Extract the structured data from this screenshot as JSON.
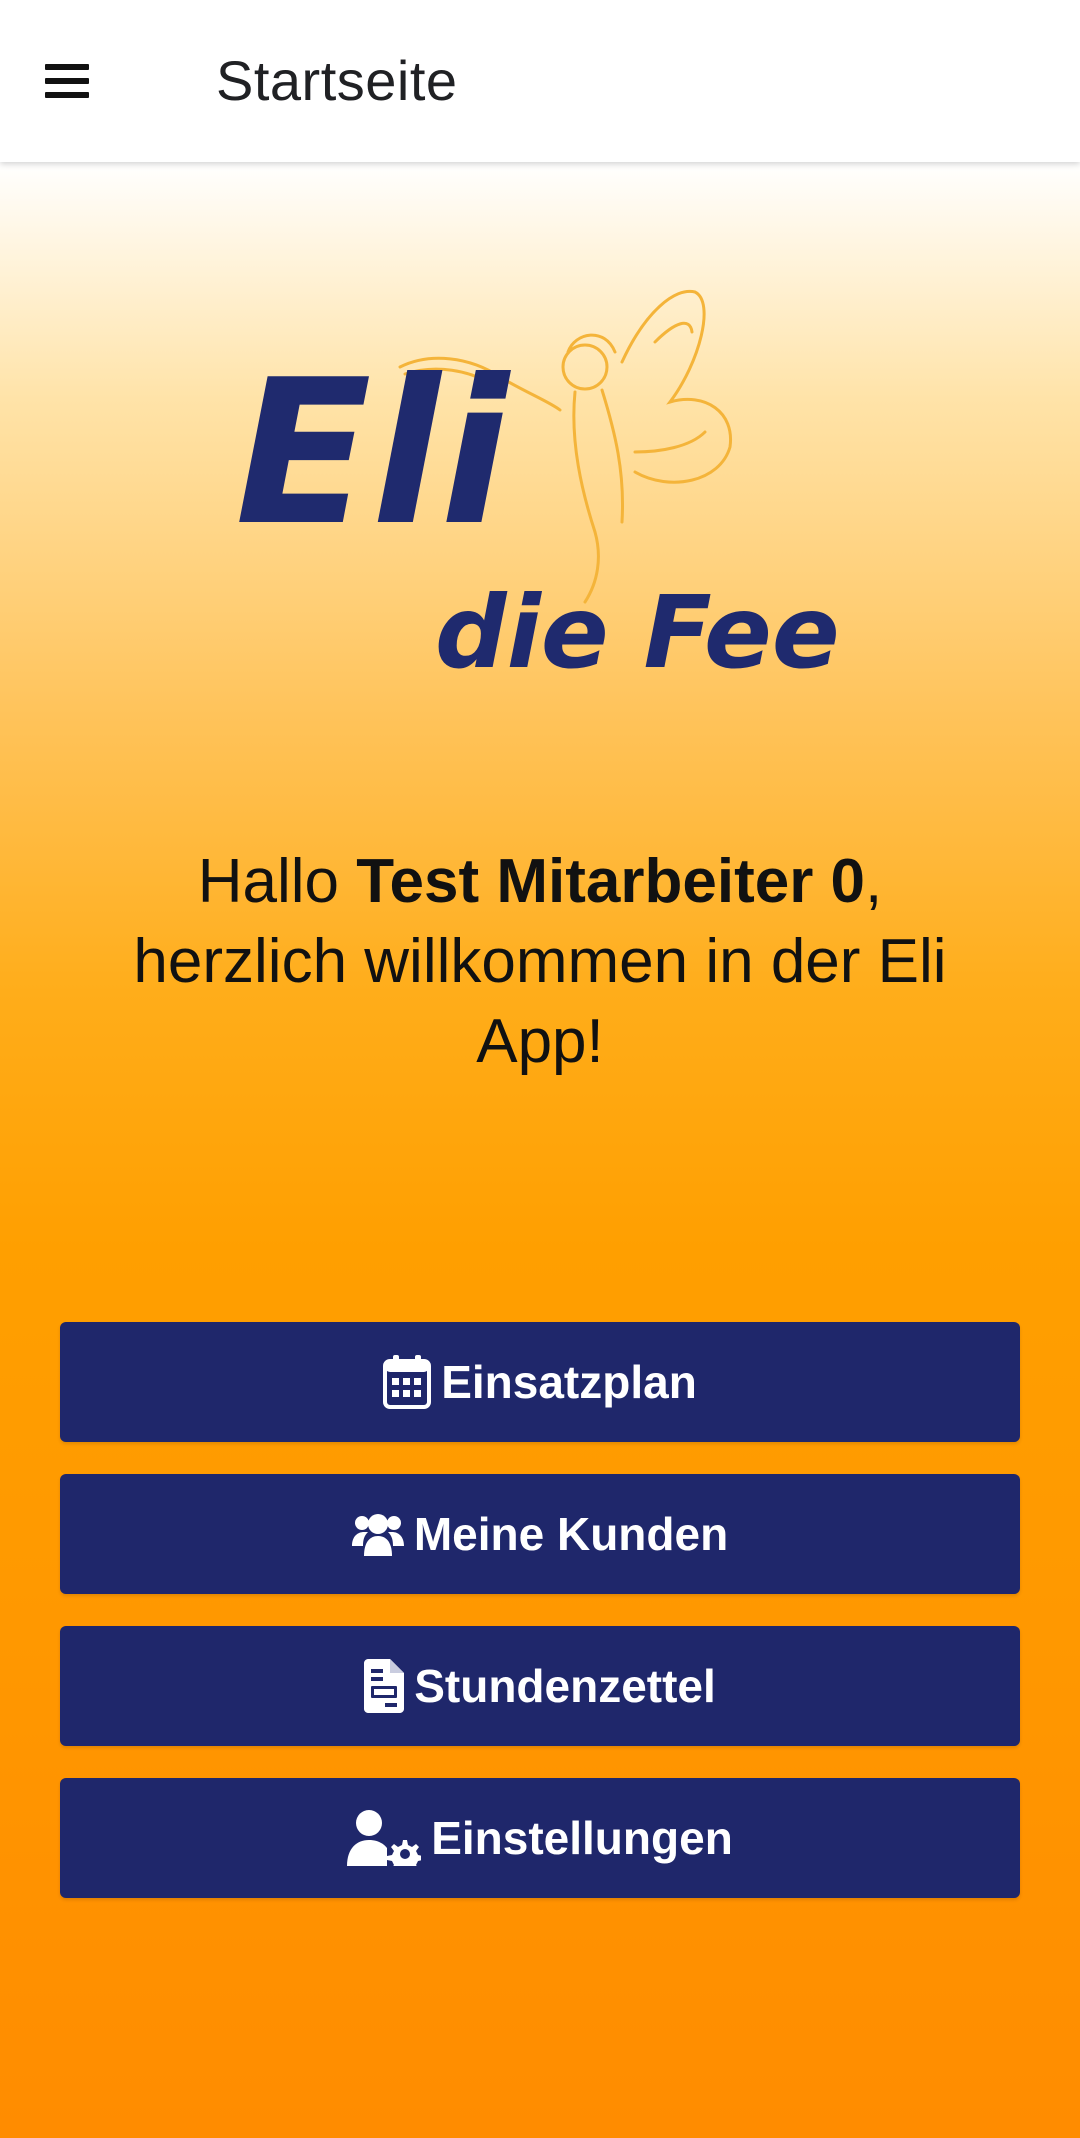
{
  "appbar": {
    "title": "Startseite",
    "menu_icon": "hamburger-menu-icon"
  },
  "logo": {
    "line1": "Eli",
    "line2": "die Fee",
    "icon": "fairy-logo"
  },
  "greeting": {
    "prefix": "Hallo ",
    "name": "Test Mitarbeiter 0",
    "suffix": ",",
    "line2": "herzlich willkommen in der Eli",
    "line3": "App!"
  },
  "buttons": [
    {
      "label": "Einsatzplan",
      "icon": "calendar-icon"
    },
    {
      "label": "Meine Kunden",
      "icon": "users-icon"
    },
    {
      "label": "Stundenzettel",
      "icon": "document-icon"
    },
    {
      "label": "Einstellungen",
      "icon": "user-settings-icon"
    }
  ],
  "colors": {
    "button_bg": "#1f276b",
    "logo_text": "#1f2a6e",
    "logo_fairy": "#f4b43a",
    "gradient_bottom": "#ff8c00"
  }
}
